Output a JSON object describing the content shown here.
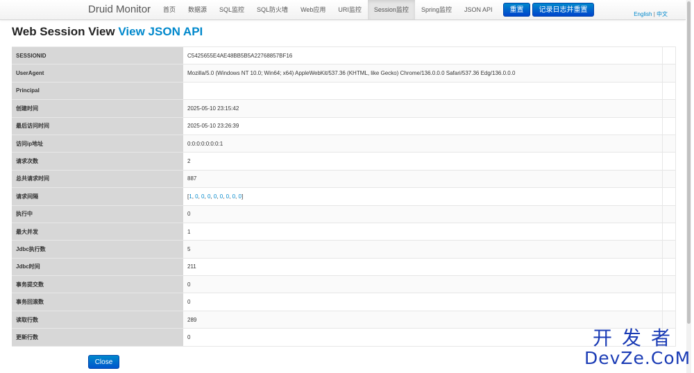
{
  "navbar": {
    "brand": "Druid Monitor",
    "items": [
      "首页",
      "数据源",
      "SQL监控",
      "SQL防火墙",
      "Web应用",
      "URI监控",
      "Session监控",
      "Spring监控",
      "JSON API"
    ],
    "active_item": "Session监控",
    "reset_label": "重置",
    "log_reset_label": "记录日志并重置",
    "lang_english": "English",
    "lang_separator": "|",
    "lang_chinese": "中文"
  },
  "page": {
    "title": "Web Session View",
    "json_link": "View JSON API"
  },
  "session": {
    "rows": [
      {
        "key": "SESSIONID",
        "value": "C5425655E4AE48BB5B5A22768857BF16"
      },
      {
        "key": "UserAgent",
        "value": "Mozilla/5.0 (Windows NT 10.0; Win64; x64) AppleWebKit/537.36 (KHTML, like Gecko) Chrome/136.0.0.0 Safari/537.36 Edg/136.0.0.0"
      },
      {
        "key": "Principal",
        "value": ""
      },
      {
        "key": "创建时间",
        "value": "2025-05-10 23:15:42"
      },
      {
        "key": "最后访问时间",
        "value": "2025-05-10 23:26:39"
      },
      {
        "key": "访问ip地址",
        "value": "0:0:0:0:0:0:0:1"
      },
      {
        "key": "请求次数",
        "value": "2"
      },
      {
        "key": "总共请求时间",
        "value": "887"
      },
      {
        "key": "请求间隔",
        "value": ""
      },
      {
        "key": "执行中",
        "value": "0"
      },
      {
        "key": "最大并发",
        "value": "1"
      },
      {
        "key": "Jdbc执行数",
        "value": "5"
      },
      {
        "key": "Jdbc时间",
        "value": "211"
      },
      {
        "key": "事务提交数",
        "value": "0"
      },
      {
        "key": "事务回滚数",
        "value": "0"
      },
      {
        "key": "读取行数",
        "value": "289"
      },
      {
        "key": "更新行数",
        "value": "0"
      }
    ],
    "request_interval": {
      "open": "[",
      "values": [
        "1",
        "0",
        "0",
        "0",
        "0",
        "0",
        "0",
        "0",
        "0"
      ],
      "separator": ", ",
      "close": "]"
    }
  },
  "footer": {
    "close_label": "Close"
  },
  "watermark": {
    "line1": "开发者",
    "line2": "DevZe.CoM"
  },
  "colors": {
    "accent": "#0088cc",
    "button": "#0055cc",
    "key_cell": "#d7d7d7",
    "watermark": "#1a3bb5"
  }
}
